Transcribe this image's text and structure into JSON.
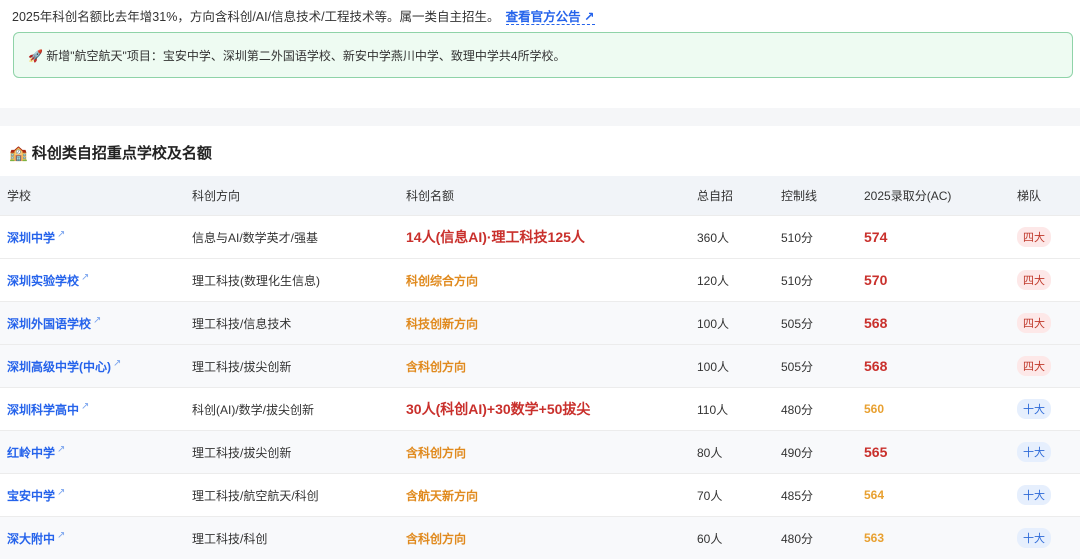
{
  "intro": {
    "text": "2025年科创名额比去年增31%，方向含科创/AI/信息技术/工程技术等。属一类自主招生。",
    "link": "查看官方公告 ↗"
  },
  "notice": {
    "icon": "🚀",
    "text": "新增\"航空航天\"项目：宝安中学、深圳第二外国语学校、新安中学燕川中学、致理中学共4所学校。"
  },
  "section": {
    "icon": "🏫",
    "title": "科创类自招重点学校及名额"
  },
  "table": {
    "headers": [
      "学校",
      "科创方向",
      "科创名额",
      "总自招",
      "控制线",
      "2025录取分(AC)",
      "梯队"
    ],
    "rows": [
      {
        "school": "深圳中学",
        "direction": "信息与AI/数学英才/强基",
        "quota": "14人(信息AI)·理工科技125人",
        "quota_style": "big",
        "total": "360人",
        "line": "510分",
        "score": "574",
        "score_style": "red",
        "tier": "四大"
      },
      {
        "school": "深圳实验学校",
        "direction": "理工科技(数理化生信息)",
        "quota": "科创综合方向",
        "quota_style": "orange",
        "total": "120人",
        "line": "510分",
        "score": "570",
        "score_style": "red",
        "tier": "四大"
      },
      {
        "school": "深圳外国语学校",
        "direction": "理工科技/信息技术",
        "quota": "科技创新方向",
        "quota_style": "orange",
        "total": "100人",
        "line": "505分",
        "score": "568",
        "score_style": "red",
        "tier": "四大"
      },
      {
        "school": "深圳高级中学(中心)",
        "direction": "理工科技/拔尖创新",
        "quota": "含科创方向",
        "quota_style": "orange",
        "total": "100人",
        "line": "505分",
        "score": "568",
        "score_style": "red",
        "tier": "四大"
      },
      {
        "school": "深圳科学高中",
        "direction": "科创(AI)/数学/拔尖创新",
        "quota": "30人(科创AI)+30数学+50拔尖",
        "quota_style": "big",
        "total": "110人",
        "line": "480分",
        "score": "560",
        "score_style": "orange",
        "tier": "十大"
      },
      {
        "school": "红岭中学",
        "direction": "理工科技/拔尖创新",
        "quota": "含科创方向",
        "quota_style": "orange",
        "total": "80人",
        "line": "490分",
        "score": "565",
        "score_style": "red",
        "tier": "十大"
      },
      {
        "school": "宝安中学",
        "direction": "理工科技/航空航天/科创",
        "quota": "含航天新方向",
        "quota_style": "orange",
        "total": "70人",
        "line": "485分",
        "score": "564",
        "score_style": "orange",
        "tier": "十大"
      },
      {
        "school": "深大附中",
        "direction": "理工科技/科创",
        "quota": "含科创方向",
        "quota_style": "orange",
        "total": "60人",
        "line": "480分",
        "score": "563",
        "score_style": "orange",
        "tier": "十大"
      }
    ]
  }
}
